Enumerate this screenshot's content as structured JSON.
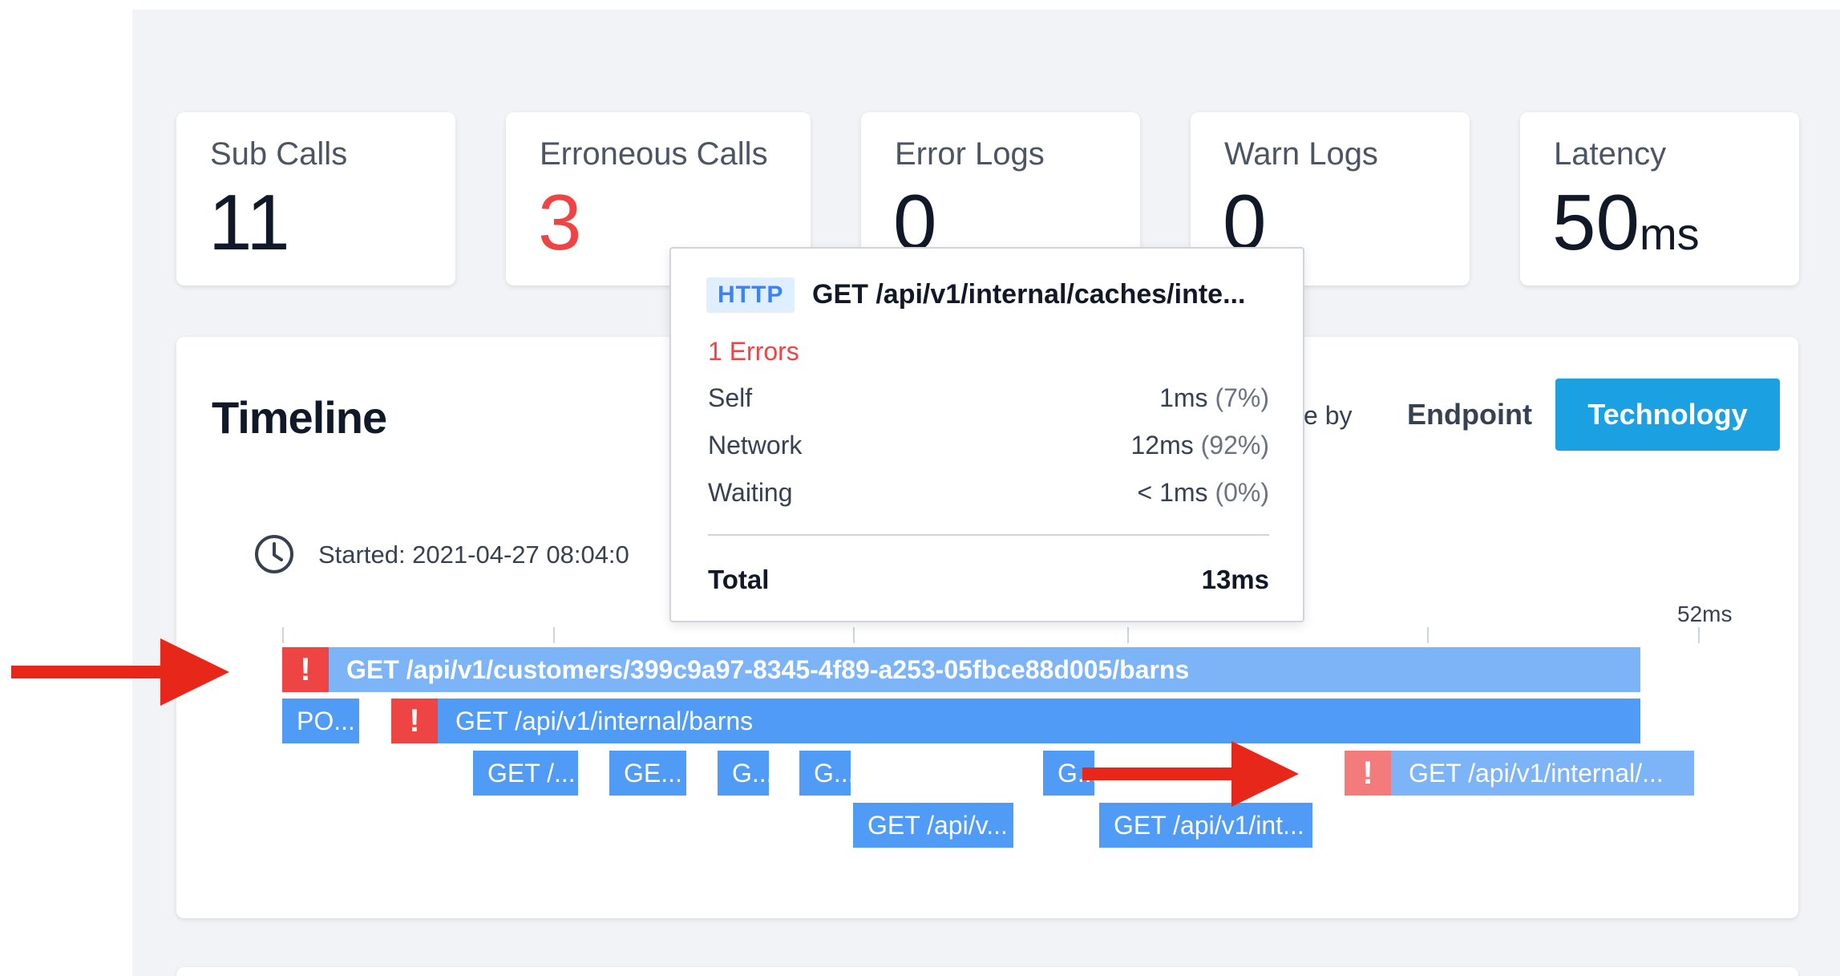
{
  "stats": [
    {
      "label": "Sub Calls",
      "value": "11",
      "unit": ""
    },
    {
      "label": "Erroneous Calls",
      "value": "3",
      "unit": ""
    },
    {
      "label": "Error Logs",
      "value": "0",
      "unit": ""
    },
    {
      "label": "Warn Logs",
      "value": "0",
      "unit": ""
    },
    {
      "label": "Latency",
      "value": "50",
      "unit": "ms"
    }
  ],
  "timeline": {
    "title": "Timeline",
    "colorize_label": "ze by",
    "endpoint_button": "Endpoint",
    "technology_button": "Technology",
    "active_mode": "Technology",
    "started": "Started: 2021-04-27 08:04:0",
    "axis_end_label": "52ms",
    "error_glyph": "!",
    "spans": [
      {
        "label": "GET /api/v1/customers/399c9a97-8345-4f89-a253-05fbce88d005/barns",
        "error": true
      },
      {
        "label": "PO...",
        "error": false
      },
      {
        "label": "GET /api/v1/internal/barns",
        "error": true
      },
      {
        "label": "GET /...",
        "error": false
      },
      {
        "label": "GE...",
        "error": false
      },
      {
        "label": "G...",
        "error": false
      },
      {
        "label": "G...",
        "error": false
      },
      {
        "label": "G...",
        "error": false
      },
      {
        "label": "GET /api/v1/internal/...",
        "error": true
      },
      {
        "label": "GET /api/v...",
        "error": false
      },
      {
        "label": "GET /api/v1/int...",
        "error": false
      }
    ]
  },
  "tooltip": {
    "badge": "HTTP",
    "title": "GET /api/v1/internal/caches/inte...",
    "errors": "1 Errors",
    "rows": [
      {
        "label": "Self",
        "value": "1ms",
        "pct": "(7%)"
      },
      {
        "label": "Network",
        "value": "12ms",
        "pct": "(92%)"
      },
      {
        "label": "Waiting",
        "value": "< 1ms",
        "pct": "(0%)"
      }
    ],
    "total_label": "Total",
    "total_value": "13ms"
  },
  "colors": {
    "accent": "#1ba1e2",
    "span_blue": "#4f9bf6",
    "span_light": "#7db4f7",
    "error": "#ef4444",
    "arrow": "#e8271b"
  }
}
